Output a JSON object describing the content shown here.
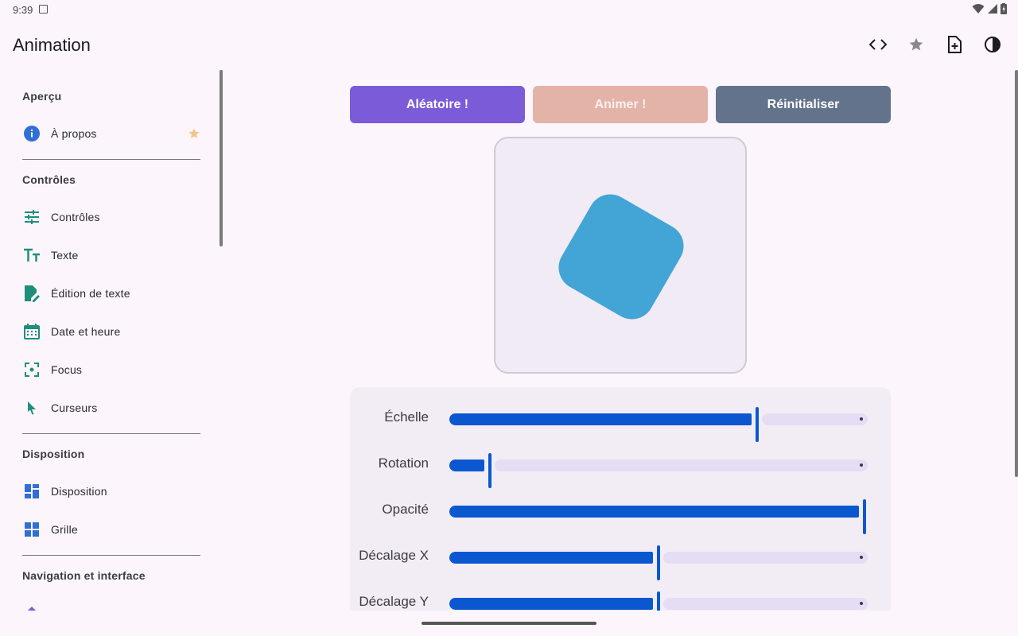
{
  "status": {
    "time": "9:39"
  },
  "appbar": {
    "title": "Animation",
    "actions": [
      "code-icon",
      "star-icon",
      "note-add-icon",
      "contrast-icon"
    ]
  },
  "sidebar": {
    "sections": [
      {
        "header": "Aperçu",
        "items": [
          {
            "label": "À propos",
            "icon": "info-icon",
            "starred": true
          }
        ]
      },
      {
        "header": "Contrôles",
        "items": [
          {
            "label": "Contrôles",
            "icon": "tune-icon"
          },
          {
            "label": "Texte",
            "icon": "text-fields-icon"
          },
          {
            "label": "Édition de texte",
            "icon": "edit-document-icon"
          },
          {
            "label": "Date et heure",
            "icon": "calendar-icon"
          },
          {
            "label": "Focus",
            "icon": "center-focus-icon"
          },
          {
            "label": "Curseurs",
            "icon": "cursor-icon"
          }
        ]
      },
      {
        "header": "Disposition",
        "items": [
          {
            "label": "Disposition",
            "icon": "dashboard-icon"
          },
          {
            "label": "Grille",
            "icon": "grid-icon"
          }
        ]
      },
      {
        "header": "Navigation et interface",
        "items": []
      }
    ]
  },
  "buttons": {
    "random": "Aléatoire !",
    "animate": "Animer !",
    "reset": "Réinitialiser"
  },
  "preview": {
    "shape_color": "#42a5d6",
    "rotation_deg": 30
  },
  "sliders": [
    {
      "label": "Échelle",
      "value": 0.74
    },
    {
      "label": "Rotation",
      "value": 0.09
    },
    {
      "label": "Opacité",
      "value": 1.0
    },
    {
      "label": "Décalage X",
      "value": 0.5
    },
    {
      "label": "Décalage Y",
      "value": 0.5
    }
  ],
  "colors": {
    "accent_purple": "#7b5bd8",
    "animate_disabled": "#e4b3a7",
    "reset_gray": "#63738b",
    "slider_blue": "#0b57d0",
    "icon_teal": "#1e8f7a",
    "icon_blue": "#2f6fd6"
  }
}
